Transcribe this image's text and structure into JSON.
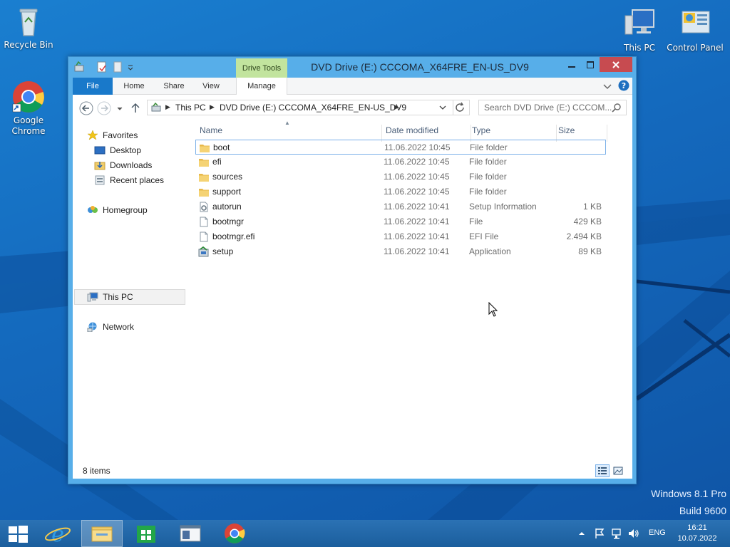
{
  "desktop": {
    "icons": [
      {
        "label": "Recycle Bin"
      },
      {
        "label": "Google Chrome"
      },
      {
        "label": "This PC"
      },
      {
        "label": "Control Panel"
      }
    ],
    "watermark_line1": "Windows 8.1 Pro",
    "watermark_line2": "Build 9600"
  },
  "window": {
    "title": "DVD Drive (E:) CCCOMA_X64FRE_EN-US_DV9",
    "context_tab": "Drive Tools",
    "ribbon_tabs": [
      "File",
      "Home",
      "Share",
      "View",
      "Manage"
    ],
    "address": {
      "crumbs": [
        "This PC",
        "DVD Drive (E:) CCCOMA_X64FRE_EN-US_DV9"
      ]
    },
    "search": {
      "placeholder": "Search DVD Drive (E:) CCCOM..."
    },
    "nav": {
      "favorites": "Favorites",
      "desktop": "Desktop",
      "downloads": "Downloads",
      "recent": "Recent places",
      "homegroup": "Homegroup",
      "thispc": "This PC",
      "network": "Network"
    },
    "columns": {
      "name": "Name",
      "date": "Date modified",
      "type": "Type",
      "size": "Size"
    },
    "files": [
      {
        "name": "boot",
        "date": "11.06.2022 10:45",
        "type": "File folder",
        "size": "",
        "icon": "folder-icon"
      },
      {
        "name": "efi",
        "date": "11.06.2022 10:45",
        "type": "File folder",
        "size": "",
        "icon": "folder-icon"
      },
      {
        "name": "sources",
        "date": "11.06.2022 10:45",
        "type": "File folder",
        "size": "",
        "icon": "folder-icon"
      },
      {
        "name": "support",
        "date": "11.06.2022 10:45",
        "type": "File folder",
        "size": "",
        "icon": "folder-icon"
      },
      {
        "name": "autorun",
        "date": "11.06.2022 10:41",
        "type": "Setup Information",
        "size": "1 KB",
        "icon": "setup-info-icon"
      },
      {
        "name": "bootmgr",
        "date": "11.06.2022 10:41",
        "type": "File",
        "size": "429 KB",
        "icon": "file-icon"
      },
      {
        "name": "bootmgr.efi",
        "date": "11.06.2022 10:41",
        "type": "EFI File",
        "size": "2.494 KB",
        "icon": "file-icon"
      },
      {
        "name": "setup",
        "date": "11.06.2022 10:41",
        "type": "Application",
        "size": "89 KB",
        "icon": "setup-app-icon"
      }
    ],
    "status": "8 items"
  },
  "taskbar": {
    "lang": "ENG",
    "time": "16:21",
    "date": "10.07.2022"
  },
  "colors": {
    "accent": "#1979ca",
    "drive_tools": "#c2e49e",
    "close": "#c74b50"
  }
}
